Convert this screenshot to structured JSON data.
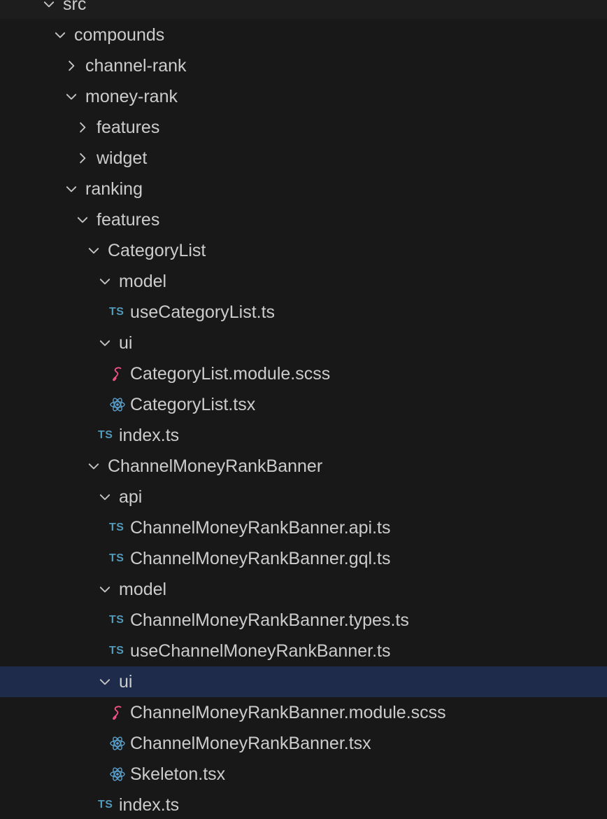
{
  "explorer": {
    "items": [
      {
        "label": "src",
        "kind": "folder",
        "expanded": true,
        "depth": 0,
        "icon": "chevron-down-icon"
      },
      {
        "label": "compounds",
        "kind": "folder",
        "expanded": true,
        "depth": 1,
        "icon": "chevron-down-icon"
      },
      {
        "label": "channel-rank",
        "kind": "folder",
        "expanded": false,
        "depth": 2,
        "icon": "chevron-right-icon"
      },
      {
        "label": "money-rank",
        "kind": "folder",
        "expanded": true,
        "depth": 2,
        "icon": "chevron-down-icon"
      },
      {
        "label": "features",
        "kind": "folder",
        "expanded": false,
        "depth": 3,
        "icon": "chevron-right-icon"
      },
      {
        "label": "widget",
        "kind": "folder",
        "expanded": false,
        "depth": 3,
        "icon": "chevron-right-icon"
      },
      {
        "label": "ranking",
        "kind": "folder",
        "expanded": true,
        "depth": 2,
        "icon": "chevron-down-icon"
      },
      {
        "label": "features",
        "kind": "folder",
        "expanded": true,
        "depth": 3,
        "icon": "chevron-down-icon"
      },
      {
        "label": "CategoryList",
        "kind": "folder",
        "expanded": true,
        "depth": 4,
        "icon": "chevron-down-icon"
      },
      {
        "label": "model",
        "kind": "folder",
        "expanded": true,
        "depth": 5,
        "icon": "chevron-down-icon"
      },
      {
        "label": "useCategoryList.ts",
        "kind": "file",
        "file_type": "ts",
        "icon_text": "TS",
        "depth": 6,
        "icon": "typescript-icon"
      },
      {
        "label": "ui",
        "kind": "folder",
        "expanded": true,
        "depth": 5,
        "icon": "chevron-down-icon"
      },
      {
        "label": "CategoryList.module.scss",
        "kind": "file",
        "file_type": "scss",
        "depth": 6,
        "icon": "sass-icon"
      },
      {
        "label": "CategoryList.tsx",
        "kind": "file",
        "file_type": "tsx",
        "depth": 6,
        "icon": "react-icon"
      },
      {
        "label": "index.ts",
        "kind": "file",
        "file_type": "ts",
        "icon_text": "TS",
        "depth": 5,
        "icon": "typescript-icon"
      },
      {
        "label": "ChannelMoneyRankBanner",
        "kind": "folder",
        "expanded": true,
        "depth": 4,
        "icon": "chevron-down-icon"
      },
      {
        "label": "api",
        "kind": "folder",
        "expanded": true,
        "depth": 5,
        "icon": "chevron-down-icon"
      },
      {
        "label": "ChannelMoneyRankBanner.api.ts",
        "kind": "file",
        "file_type": "ts",
        "icon_text": "TS",
        "depth": 6,
        "icon": "typescript-icon"
      },
      {
        "label": "ChannelMoneyRankBanner.gql.ts",
        "kind": "file",
        "file_type": "ts",
        "icon_text": "TS",
        "depth": 6,
        "icon": "typescript-icon"
      },
      {
        "label": "model",
        "kind": "folder",
        "expanded": true,
        "depth": 5,
        "icon": "chevron-down-icon"
      },
      {
        "label": "ChannelMoneyRankBanner.types.ts",
        "kind": "file",
        "file_type": "ts",
        "icon_text": "TS",
        "depth": 6,
        "icon": "typescript-icon"
      },
      {
        "label": "useChannelMoneyRankBanner.ts",
        "kind": "file",
        "file_type": "ts",
        "icon_text": "TS",
        "depth": 6,
        "icon": "typescript-icon"
      },
      {
        "label": "ui",
        "kind": "folder",
        "expanded": true,
        "depth": 5,
        "selected": true,
        "icon": "chevron-down-icon"
      },
      {
        "label": "ChannelMoneyRankBanner.module.scss",
        "kind": "file",
        "file_type": "scss",
        "depth": 6,
        "icon": "sass-icon"
      },
      {
        "label": "ChannelMoneyRankBanner.tsx",
        "kind": "file",
        "file_type": "tsx",
        "depth": 6,
        "icon": "react-icon"
      },
      {
        "label": "Skeleton.tsx",
        "kind": "file",
        "file_type": "tsx",
        "depth": 6,
        "icon": "react-icon"
      },
      {
        "label": "index.ts",
        "kind": "file",
        "file_type": "ts",
        "icon_text": "TS",
        "depth": 5,
        "icon": "typescript-icon"
      }
    ]
  },
  "colors": {
    "background": "#181818",
    "selected_row": "#1f2b4a",
    "text": "#cccccc",
    "chevron": "#c5c5c5",
    "typescript": "#519aba",
    "sass": "#f55385",
    "react": "#5a9ec9"
  }
}
